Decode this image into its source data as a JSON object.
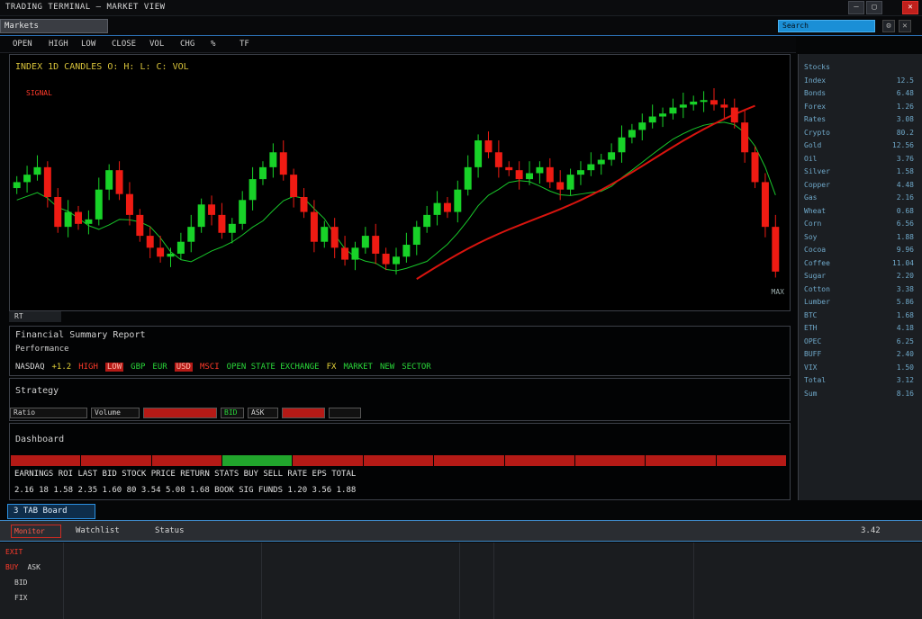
{
  "titlebar": {
    "title": "TRADING TERMINAL — MARKET VIEW",
    "min": "–",
    "max": "▢",
    "close": "✕"
  },
  "bar2": {
    "logo": "Markets",
    "search": "Search",
    "icon_a": "⚙",
    "icon_b": "✕"
  },
  "toolbar": [
    "OPEN",
    "HIGH",
    "LOW",
    "CLOSE",
    "VOL",
    "CHG",
    "%",
    "TF"
  ],
  "chart": {
    "header": "INDEX  1D  CANDLES  O:  H:  L:  C:  VOL",
    "tag": "SIGNAL",
    "corner": "MAX",
    "colors": {
      "up": "#18d228",
      "down": "#ef1b13",
      "ma": "#18c62a",
      "trend": "#d8140e",
      "bg": "#000000"
    }
  },
  "chart_data": {
    "type": "candlestick",
    "series": [
      {
        "name": "price",
        "values": [
          140,
          145,
          150,
          130,
          110,
          120,
          112,
          115,
          135,
          148,
          132,
          118,
          104,
          96,
          90,
          92,
          100,
          110,
          125,
          118,
          106,
          112,
          128,
          142,
          150,
          160,
          145,
          130,
          120,
          100,
          110,
          96,
          88,
          96,
          104,
          92,
          85,
          90,
          98,
          110,
          118,
          126,
          120,
          135,
          150,
          168,
          160,
          150,
          148,
          142,
          146,
          150,
          140,
          135,
          145,
          148,
          152,
          155,
          160,
          170,
          175,
          180,
          184,
          186,
          190,
          192,
          194,
          195,
          192,
          190,
          180,
          160,
          140,
          110,
          80
        ]
      }
    ],
    "ylim": [
      60,
      200
    ]
  },
  "separator_label": "RT",
  "panel1": {
    "title": "Financial Summary Report",
    "line1": "Performance",
    "tickers": [
      {
        "t": "NASDAQ",
        "c": "w"
      },
      {
        "t": "+1.2",
        "c": "y"
      },
      {
        "t": "HIGH",
        "c": "r"
      },
      {
        "t": "LOW",
        "c": "red-bg"
      },
      {
        "t": "GBP",
        "c": "g"
      },
      {
        "t": "EUR",
        "c": "g"
      },
      {
        "t": "USD",
        "c": "red-bg"
      },
      {
        "t": "MSCI",
        "c": "r"
      },
      {
        "t": "OPEN STATE EXCHANGE",
        "c": "g"
      },
      {
        "t": "FX",
        "c": "y"
      },
      {
        "t": "MARKET",
        "c": "g"
      },
      {
        "t": "NEW",
        "c": "g"
      },
      {
        "t": "SECTOR",
        "c": "g"
      }
    ]
  },
  "panel2": {
    "title": "Strategy",
    "cells": [
      {
        "t": "Ratio",
        "w": 86,
        "c": "#cfcfcf",
        "bg": "#111"
      },
      {
        "t": "Volume",
        "w": 54,
        "c": "#cfcfcf",
        "bg": "#111"
      },
      {
        "t": "",
        "w": 82,
        "c": "#fff",
        "bg": "#b51a16"
      },
      {
        "t": "BID",
        "w": 26,
        "c": "#2ad83a",
        "bg": "#111"
      },
      {
        "t": "ASK",
        "w": 34,
        "c": "#cfcfcf",
        "bg": "#111"
      },
      {
        "t": "",
        "w": 48,
        "c": "#fff",
        "bg": "#b51a16"
      },
      {
        "t": "",
        "w": 36,
        "c": "#cfcfcf",
        "bg": "#111"
      }
    ]
  },
  "panel3": {
    "title": "Dashboard",
    "heat": [
      "#b51a16",
      "#b51a16",
      "#b51a16",
      "#21a52c",
      "#b51a16",
      "#b51a16",
      "#b51a16",
      "#b51a16",
      "#b51a16",
      "#b51a16",
      "#b51a16"
    ],
    "row1": "EARNINGS   ROI   LAST   BID   STOCK   PRICE   RETURN   STATS   BUY SELL   RATE   EPS   TOTAL",
    "row2": "2.16  18  1.58  2.35  1.60  80  3.54  5.08  1.68  BOOK  SIG  FUNDS  1.20  3.56  1.88"
  },
  "sidebar": [
    {
      "l": "Stocks",
      "r": ""
    },
    {
      "l": "Index",
      "r": "12.5"
    },
    {
      "l": "Bonds",
      "r": "6.48"
    },
    {
      "l": "Forex",
      "r": "1.26"
    },
    {
      "l": "Rates",
      "r": "3.08"
    },
    {
      "l": "Crypto",
      "r": "80.2"
    },
    {
      "l": "Gold",
      "r": "12.56"
    },
    {
      "l": "Oil",
      "r": "3.76"
    },
    {
      "l": "Silver",
      "r": "1.58"
    },
    {
      "l": "Copper",
      "r": "4.48"
    },
    {
      "l": "Gas",
      "r": "2.16"
    },
    {
      "l": "Wheat",
      "r": "0.68"
    },
    {
      "l": "Corn",
      "r": "6.56"
    },
    {
      "l": "Soy",
      "r": "1.88"
    },
    {
      "l": "Cocoa",
      "r": "9.96"
    },
    {
      "l": "Coffee",
      "r": "11.04"
    },
    {
      "l": "Sugar",
      "r": "2.20"
    },
    {
      "l": "Cotton",
      "r": "3.38"
    },
    {
      "l": "Lumber",
      "r": "5.86"
    },
    {
      "l": "BTC",
      "r": "1.68"
    },
    {
      "l": "ETH",
      "r": "4.18"
    },
    {
      "l": "OPEC",
      "r": "6.25"
    },
    {
      "l": "BUFF",
      "r": "2.40"
    },
    {
      "l": "VIX",
      "r": "1.50"
    },
    {
      "l": "Total",
      "r": "3.12"
    },
    {
      "l": "Sum",
      "r": "8.16"
    }
  ],
  "bottom": {
    "tab": "3 TAB  Board",
    "red_btn": "Monitor",
    "items": [
      "Watchlist",
      "Status"
    ],
    "right": "3.42",
    "rows": [
      {
        "a": "EXIT",
        "b": ""
      },
      {
        "a": "BUY",
        "b": "ASK"
      },
      {
        "a": "",
        "b": "BID"
      },
      {
        "a": "",
        "b": "FIX"
      }
    ]
  }
}
